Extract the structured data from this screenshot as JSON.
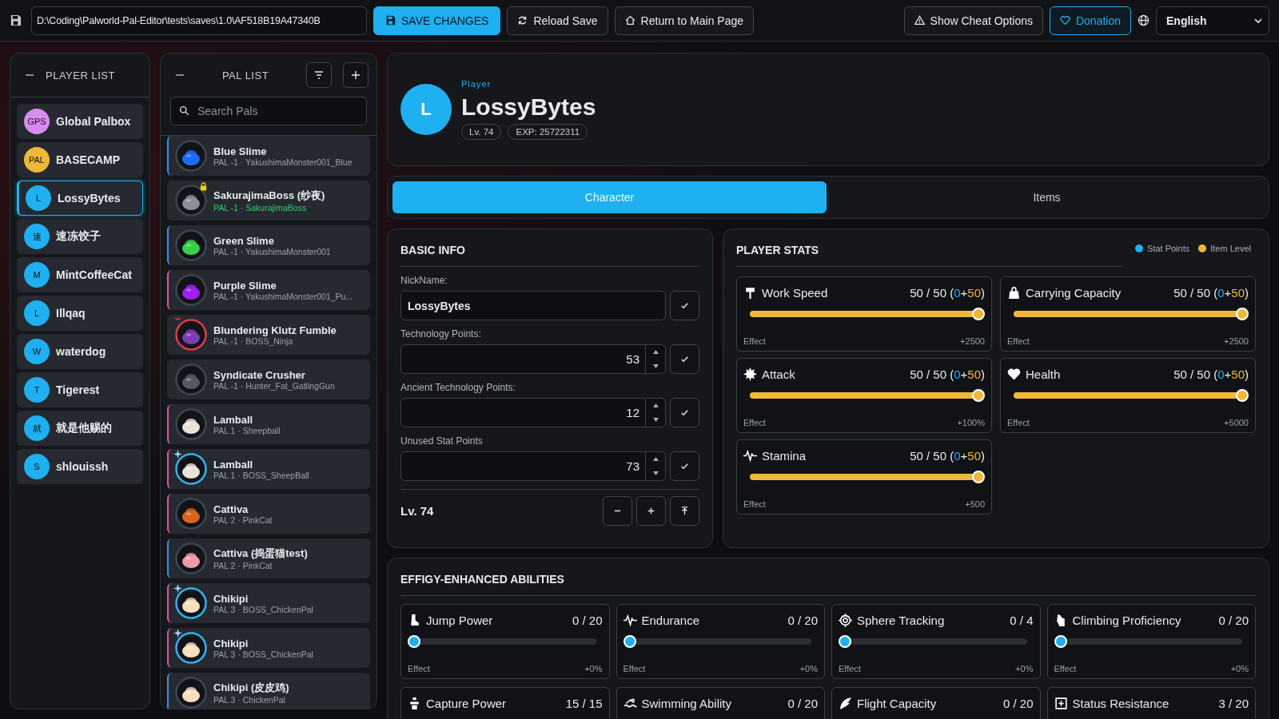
{
  "toolbar": {
    "path": "D:\\Coding\\Palworld-Pal-Editor\\tests\\saves\\1.0\\AF518B19A47340B",
    "save": "SAVE CHANGES",
    "reload": "Reload Save",
    "return": "Return to Main Page",
    "cheat": "Show Cheat Options",
    "donation": "Donation",
    "language": "English"
  },
  "player_list": {
    "title": "PLAYER LIST",
    "items": [
      {
        "initials": "GPS",
        "name": "Global Palbox",
        "color": "#d98cf0",
        "selected": false
      },
      {
        "initials": "PAL",
        "name": "BASECAMP",
        "color": "#f0b83a",
        "selected": false
      },
      {
        "initials": "L",
        "name": "LossyBytes",
        "color": "#1eb0f0",
        "selected": true
      },
      {
        "initials": "速",
        "name": "速冻饺子",
        "color": "#1eb0f0",
        "selected": false
      },
      {
        "initials": "M",
        "name": "MintCoffeeCat",
        "color": "#1eb0f0",
        "selected": false
      },
      {
        "initials": "L",
        "name": "Illqaq",
        "color": "#1eb0f0",
        "selected": false
      },
      {
        "initials": "W",
        "name": "waterdog",
        "color": "#1eb0f0",
        "selected": false
      },
      {
        "initials": "T",
        "name": "Tigerest",
        "color": "#1eb0f0",
        "selected": false
      },
      {
        "initials": "就",
        "name": "就是他赐的",
        "color": "#1eb0f0",
        "selected": false
      },
      {
        "initials": "S",
        "name": "shlouissh",
        "color": "#1eb0f0",
        "selected": false
      }
    ]
  },
  "pal_list": {
    "title": "PAL LIST",
    "search": {
      "placeholder": "Search Pals"
    },
    "items": [
      {
        "name": "Blue Slime",
        "subtitle": "PAL -1 · YakushimaMonster001_Blue",
        "color": "#3a8ee6",
        "kind": "normal"
      },
      {
        "name": "SakurajimaBoss (纱夜)",
        "subtitle": "PAL -1 · SakurajimaBoss",
        "kind": "unique"
      },
      {
        "name": "Green Slime",
        "subtitle": "PAL -1 · YakushimaMonster001",
        "color": "#3a8ee6",
        "kind": "normal"
      },
      {
        "name": "Purple Slime",
        "subtitle": "PAL -1 · YakushimaMonster001_Pu...",
        "color": "#e0559a",
        "kind": "normal"
      },
      {
        "name": "Blundering Klutz Fumble",
        "subtitle": "PAL -1 · BOSS_Ninja",
        "kind": "alpha"
      },
      {
        "name": "Syndicate Crusher",
        "subtitle": "PAL -1 · Hunter_Fat_GatlingGun",
        "kind": "normal"
      },
      {
        "name": "Lamball",
        "subtitle": "PAL 1 · Sheepball",
        "color": "#e0559a",
        "kind": "normal"
      },
      {
        "name": "Lamball",
        "subtitle": "PAL 1 · BOSS_SheepBall",
        "color": "#e0559a",
        "kind": "boss"
      },
      {
        "name": "Cattiva",
        "subtitle": "PAL 2 · PinkCat",
        "color": "#e0559a",
        "kind": "normal"
      },
      {
        "name": "Cattiva (捣蛋猫test)",
        "subtitle": "PAL 2 · PinkCat",
        "color": "#3a8ee6",
        "kind": "normal"
      },
      {
        "name": "Chikipi",
        "subtitle": "PAL 3 · BOSS_ChickenPal",
        "color": "#e0559a",
        "kind": "boss"
      },
      {
        "name": "Chikipi",
        "subtitle": "PAL 3 · BOSS_ChickenPal",
        "color": "#e0559a",
        "kind": "boss"
      },
      {
        "name": "Chikipi (皮皮鸡)",
        "subtitle": "PAL 3 · ChickenPal",
        "color": "#3a8ee6",
        "kind": "normal"
      }
    ]
  },
  "header": {
    "role": "Player",
    "initial": "L",
    "name": "LossyBytes",
    "badges": [
      "Lv. 74",
      "EXP: 25722311"
    ]
  },
  "tabs": [
    {
      "label": "Character",
      "selected": true
    },
    {
      "label": "Items",
      "selected": false
    }
  ],
  "basic_info": {
    "title": "BASIC INFO",
    "fields": [
      {
        "label": "NickName:",
        "value": "LossyBytes",
        "kind": "text"
      },
      {
        "label": "Technology Points:",
        "value": "53",
        "kind": "number"
      },
      {
        "label": "Ancient Technology Points:",
        "value": "12",
        "kind": "number"
      },
      {
        "label": "Unused Stat Points",
        "value": "73",
        "kind": "number"
      }
    ],
    "level": "Lv. 74"
  },
  "player_stats": {
    "title": "PLAYER STATS",
    "legend": [
      {
        "label": "Stat Points",
        "color": "#1eb0f0"
      },
      {
        "label": "Item Level",
        "color": "#f0b83a"
      }
    ],
    "stats": [
      {
        "name": "Work Speed",
        "reading": [
          {
            "text": "50 / 50 (",
            "kind": "plain"
          },
          {
            "text": "0",
            "kind": "stat"
          },
          {
            "text": "+",
            "kind": "plain"
          },
          {
            "text": "50",
            "kind": "item"
          },
          {
            "text": ")",
            "kind": "plain"
          }
        ],
        "level": 1,
        "effect_label": "Effect",
        "effect": "+2500"
      },
      {
        "name": "Carrying Capacity",
        "reading": [
          {
            "text": "50 / 50 (",
            "kind": "plain"
          },
          {
            "text": "0",
            "kind": "stat"
          },
          {
            "text": "+",
            "kind": "plain"
          },
          {
            "text": "50",
            "kind": "item"
          },
          {
            "text": ")",
            "kind": "plain"
          }
        ],
        "level": 1,
        "effect_label": "Effect",
        "effect": "+2500"
      },
      {
        "name": "Attack",
        "reading": [
          {
            "text": "50 / 50 (",
            "kind": "plain"
          },
          {
            "text": "0",
            "kind": "stat"
          },
          {
            "text": "+",
            "kind": "plain"
          },
          {
            "text": "50",
            "kind": "item"
          },
          {
            "text": ")",
            "kind": "plain"
          }
        ],
        "level": 1,
        "effect_label": "Effect",
        "effect": "+100%"
      },
      {
        "name": "Health",
        "reading": [
          {
            "text": "50 / 50 (",
            "kind": "plain"
          },
          {
            "text": "0",
            "kind": "stat"
          },
          {
            "text": "+",
            "kind": "plain"
          },
          {
            "text": "50",
            "kind": "item"
          },
          {
            "text": ")",
            "kind": "plain"
          }
        ],
        "level": 1,
        "effect_label": "Effect",
        "effect": "+5000"
      },
      {
        "name": "Stamina",
        "reading": [
          {
            "text": "50 / 50 (",
            "kind": "plain"
          },
          {
            "text": "0",
            "kind": "stat"
          },
          {
            "text": "+",
            "kind": "plain"
          },
          {
            "text": "50",
            "kind": "item"
          },
          {
            "text": ")",
            "kind": "plain"
          }
        ],
        "level": 1,
        "effect_label": "Effect",
        "effect": "+500"
      }
    ]
  },
  "effigy": {
    "title": "EFFIGY-ENHANCED ABILITIES",
    "abilities": [
      {
        "name": "Jump Power",
        "reading": "0 / 20",
        "level": 0,
        "effect_label": "Effect",
        "effect": "+0%"
      },
      {
        "name": "Endurance",
        "reading": "0 / 20",
        "level": 0,
        "effect_label": "Effect",
        "effect": "+0%"
      },
      {
        "name": "Sphere Tracking",
        "reading": "0 / 4",
        "level": 0,
        "effect_label": "Effect",
        "effect": "+0%"
      },
      {
        "name": "Climbing Proficiency",
        "reading": "0 / 20",
        "level": 0,
        "effect_label": "Effect",
        "effect": "+0%"
      },
      {
        "name": "Capture Power",
        "reading": "15 / 15"
      },
      {
        "name": "Swimming Ability",
        "reading": "0 / 20"
      },
      {
        "name": "Flight Capacity",
        "reading": "0 / 20"
      },
      {
        "name": "Status Resistance",
        "reading": "3 / 20"
      }
    ]
  }
}
